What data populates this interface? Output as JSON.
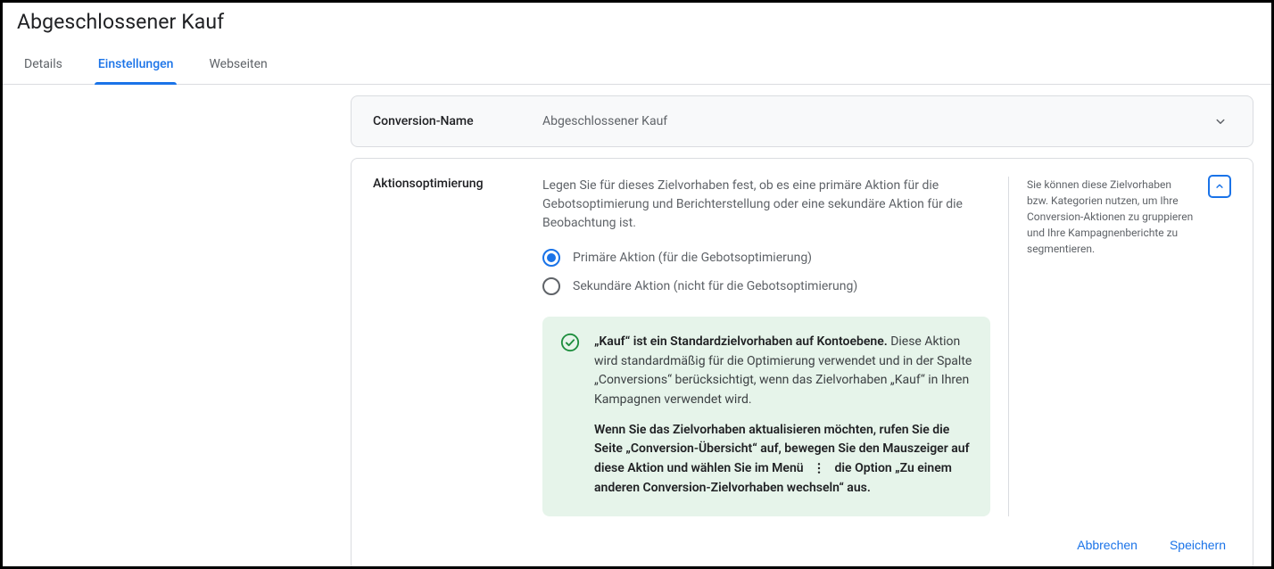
{
  "page": {
    "title": "Abgeschlossener Kauf"
  },
  "tabs": {
    "details": "Details",
    "settings": "Einstellungen",
    "websites": "Webseiten"
  },
  "panel1": {
    "label": "Conversion-Name",
    "value": "Abgeschlossener Kauf"
  },
  "opt": {
    "title": "Aktionsoptimierung",
    "desc": "Legen Sie für dieses Zielvorhaben fest, ob es eine primäre Aktion für die Gebotsoptimierung und Berichterstellung oder eine sekundäre Aktion für die Beobachtung ist.",
    "radio_primary": "Primäre Aktion (für die Gebotsoptimierung)",
    "radio_secondary": "Sekundäre Aktion (nicht für die Gebotsoptimierung)",
    "box_bold1": "„Kauf“ ist ein Standardzielvorhaben auf Kontoebene.",
    "box_text1": " Diese Aktion wird standardmäßig für die Optimierung verwendet und in der Spalte „Conversions“ berücksichtigt, wenn das Zielvorhaben „Kauf“ in Ihren Kampagnen verwendet wird.",
    "box_bold2a": "Wenn Sie das Zielvorhaben aktualisieren möchten, rufen Sie die Seite „Conversion-Übersicht“ auf, bewegen Sie den Mauszeiger auf diese Aktion und wählen Sie im Menü ",
    "box_bold2b": " die Option „Zu einem anderen Conversion-Zielvorhaben wechseln“ aus.",
    "help": "Sie können diese Zielvorhaben bzw. Kategorien nutzen, um Ihre Conversion-Aktionen zu gruppieren und Ihre Kampagnenberichte zu segmentieren."
  },
  "footer": {
    "cancel": "Abbrechen",
    "save": "Speichern"
  }
}
